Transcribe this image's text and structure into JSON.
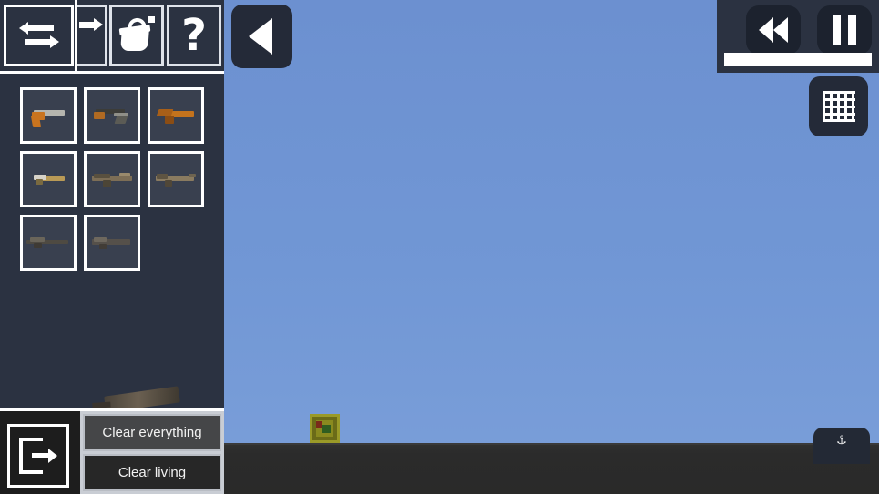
{
  "app": {
    "title": "Sandbox Weapon Spawner",
    "scene": {
      "sky_color": "#7197d5",
      "ground_color": "#2b2b2b",
      "entity": {
        "name": "crate-entity",
        "color": "#8a8a1f"
      }
    }
  },
  "back_button": {
    "name": "back-button",
    "icon": "back-triangle-icon"
  },
  "toolbar": {
    "buttons": [
      {
        "id": "swap",
        "icon": "swap-arrows-icon",
        "label": "Swap",
        "selected": true
      },
      {
        "id": "move",
        "icon": "arrow-right-icon",
        "label": "Move",
        "selected": false
      },
      {
        "id": "paint",
        "icon": "paint-bucket-icon",
        "label": "Paint",
        "selected": false
      },
      {
        "id": "help",
        "icon": "question-mark-icon",
        "label": "Help",
        "selected": false
      }
    ]
  },
  "weapons": {
    "rows": 3,
    "columns": 3,
    "items": [
      {
        "index": 1,
        "name": "pistol",
        "tint": "#c9741f"
      },
      {
        "index": 2,
        "name": "machine-pistol",
        "tint": "#b06a22"
      },
      {
        "index": 3,
        "name": "sawed-off-shotgun",
        "tint": "#c4731d"
      },
      {
        "index": 4,
        "name": "smg",
        "tint": "#b99a56"
      },
      {
        "index": 5,
        "name": "assault-rifle",
        "tint": "#7d6e56"
      },
      {
        "index": 6,
        "name": "carbine",
        "tint": "#8a7b60"
      },
      {
        "index": 7,
        "name": "sniper-rifle",
        "tint": "#4e4a42"
      },
      {
        "index": 8,
        "name": "battle-rifle",
        "tint": "#55504a"
      }
    ]
  },
  "loose_weapon": {
    "name": "dropped-rifle"
  },
  "exit_button": {
    "name": "exit-button",
    "icon": "exit-door-icon",
    "label": "Exit"
  },
  "clear_panel": {
    "buttons": [
      {
        "id": "clear-everything",
        "label": "Clear everything"
      },
      {
        "id": "clear-living",
        "label": "Clear living"
      }
    ]
  },
  "playback": {
    "rewind": {
      "name": "rewind-button",
      "icon": "rewind-icon",
      "label": "Rewind"
    },
    "pause": {
      "name": "pause-button",
      "icon": "pause-icon",
      "label": "Pause"
    },
    "progress": {
      "name": "progress-bar",
      "percent": 100,
      "fill_color": "#ffffff"
    }
  },
  "grid_button": {
    "name": "grid-toggle-button",
    "icon": "grid-icon",
    "label": "Grid"
  },
  "anchor_button": {
    "name": "anchor-button",
    "icon": "anchor-icon",
    "glyph": "⚓"
  }
}
